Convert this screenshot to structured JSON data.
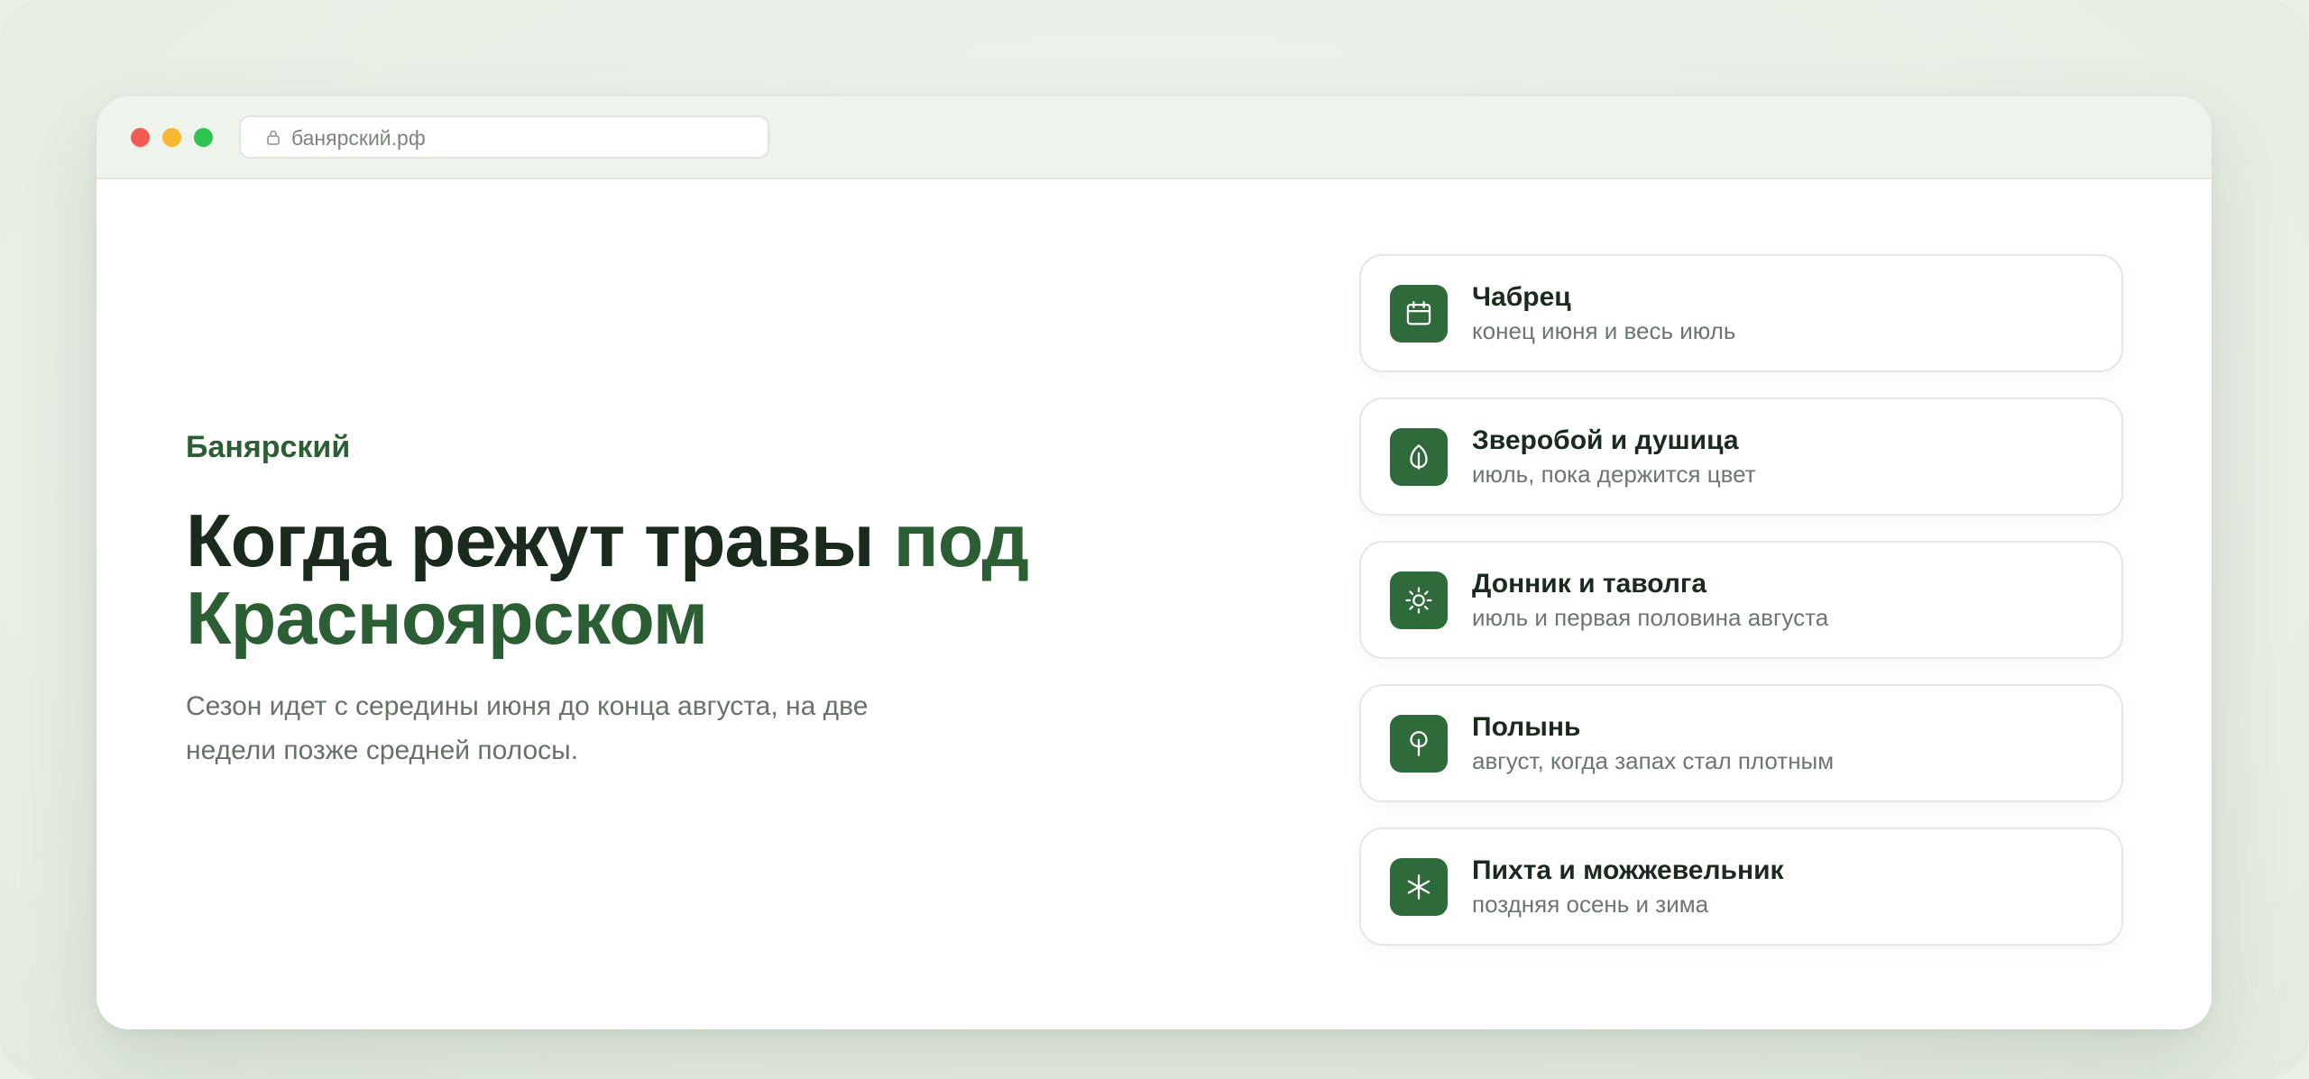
{
  "browser": {
    "url": "банярский.рф"
  },
  "hero": {
    "brand": "Банярский",
    "headline_main": "Когда режут травы ",
    "headline_accent": "под Красноярском",
    "lead": "Сезон идет с середины июня до конца августа, на две недели позже средней полосы."
  },
  "herbs": [
    {
      "icon": "calendar-icon",
      "title": "Чабрец",
      "period": "конец июня и весь июль"
    },
    {
      "icon": "leaf-icon",
      "title": "Зверобой и душица",
      "period": "июль, пока держится цвет"
    },
    {
      "icon": "sun-icon",
      "title": "Донник и таволга",
      "period": "июль и первая половина августа"
    },
    {
      "icon": "tree-icon",
      "title": "Полынь",
      "period": "август, когда запах стал плотным"
    },
    {
      "icon": "snowflake-icon",
      "title": "Пихта и можжевельник",
      "period": "поздняя осень и зима"
    }
  ],
  "colors": {
    "accent": "#2c5e34",
    "icon_bg": "#2f6a3a",
    "background": "#e9f0e6"
  }
}
